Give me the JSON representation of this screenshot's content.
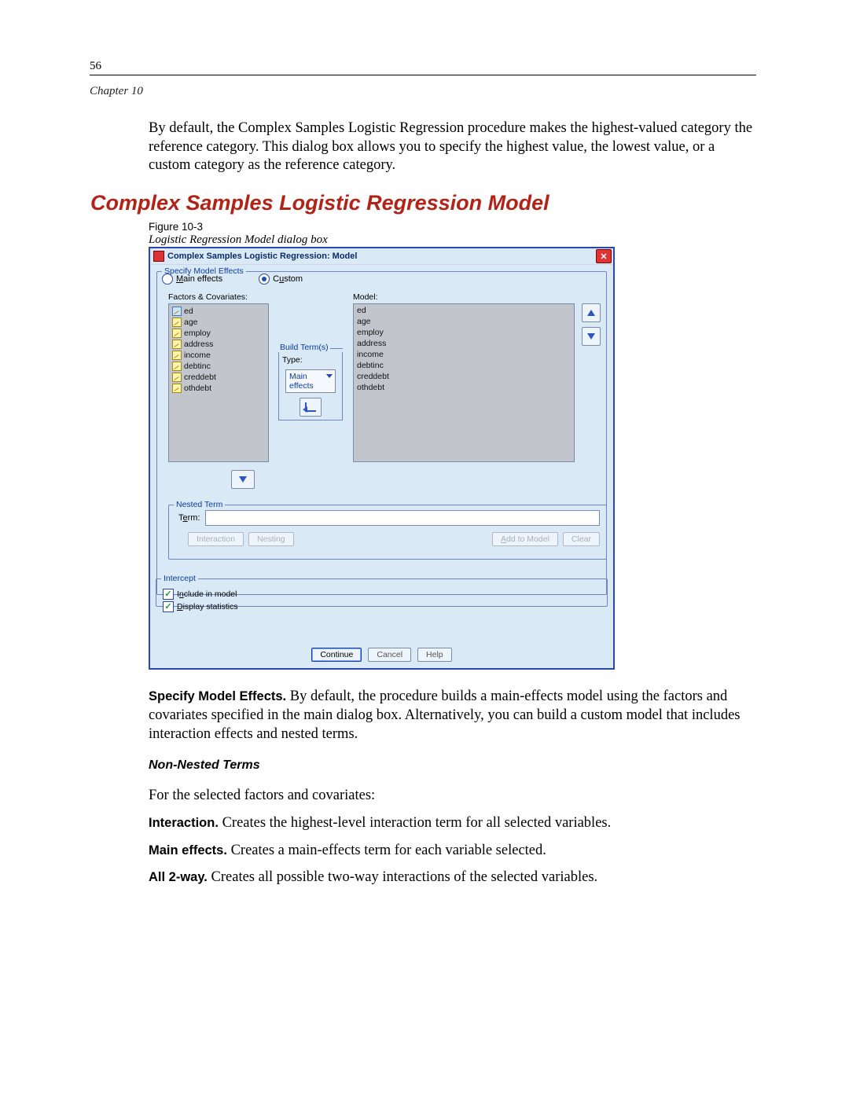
{
  "page_number": "56",
  "chapter": "Chapter 10",
  "intro_para": "By default, the Complex Samples Logistic Regression procedure makes the highest-valued category the reference category. This dialog box allows you to specify the highest value, the lowest value, or a custom category as the reference category.",
  "section_heading": "Complex Samples Logistic Regression Model",
  "figure_label": "Figure 10-3",
  "figure_caption": "Logistic Regression Model dialog box",
  "dialog": {
    "title": "Complex Samples Logistic Regression: Model",
    "specify_legend": "Specify Model Effects",
    "radio_main": "Main effects",
    "radio_custom": "Custom",
    "radio_main_key": "M",
    "radio_custom_key": "u",
    "fc_label": "Factors & Covariates:",
    "model_label": "Model:",
    "build_label": "Build Term(s)",
    "type_label": "Type:",
    "type_value": "Main effects",
    "factors": [
      {
        "name": "ed",
        "kind": "cat"
      },
      {
        "name": "age",
        "kind": "cov"
      },
      {
        "name": "employ",
        "kind": "cov"
      },
      {
        "name": "address",
        "kind": "cov"
      },
      {
        "name": "income",
        "kind": "cov"
      },
      {
        "name": "debtinc",
        "kind": "cov"
      },
      {
        "name": "creddebt",
        "kind": "cov"
      },
      {
        "name": "othdebt",
        "kind": "cov"
      }
    ],
    "model_items": [
      "ed",
      "age",
      "employ",
      "address",
      "income",
      "debtinc",
      "creddebt",
      "othdebt"
    ],
    "nested_legend": "Nested Term",
    "term_label": "Term:",
    "term_key": "e",
    "term_value": "",
    "btn_interaction": "Interaction",
    "btn_nesting": "Nesting",
    "btn_add_to_model": "Add to Model",
    "btn_clear": "Clear",
    "intercept_legend": "Intercept",
    "chk_include": "Include in model",
    "chk_include_key": "n",
    "chk_display": "Display statistics",
    "chk_display_key": "D",
    "btn_continue": "Continue",
    "btn_cancel": "Cancel",
    "btn_help": "Help"
  },
  "specify_para_lead": "Specify Model Effects.",
  "specify_para": " By default, the procedure builds a main-effects model using the factors and covariates specified in the main dialog box. Alternatively, you can build a custom model that includes interaction effects and nested terms.",
  "nonnested_heading": "Non-Nested Terms",
  "nonnested_intro": "For the selected factors and covariates:",
  "rows": [
    {
      "lead": "Interaction.",
      "text": " Creates the highest-level interaction term for all selected variables."
    },
    {
      "lead": "Main effects.",
      "text": " Creates a main-effects term for each variable selected."
    },
    {
      "lead": "All 2-way.",
      "text": " Creates all possible two-way interactions of the selected variables."
    }
  ]
}
